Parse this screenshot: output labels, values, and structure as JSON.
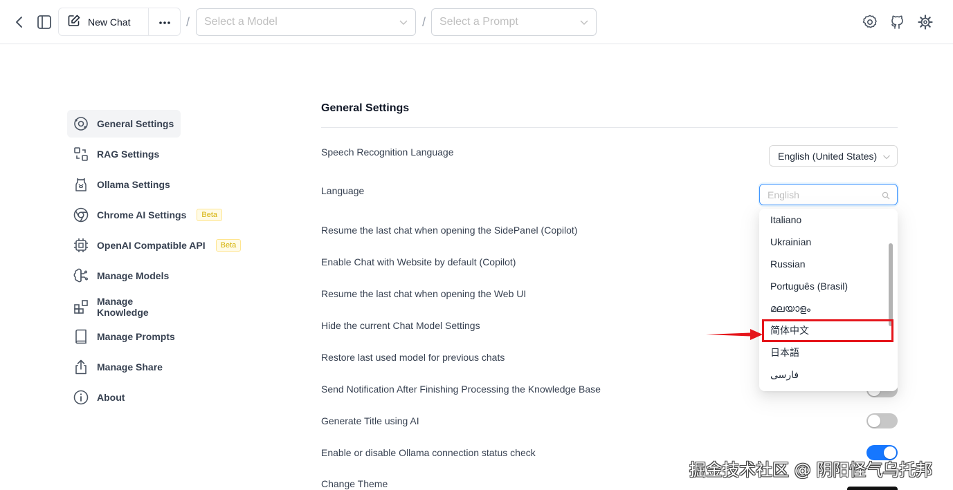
{
  "topbar": {
    "new_chat_label": "New Chat",
    "model_placeholder": "Select a Model",
    "prompt_placeholder": "Select a Prompt",
    "separator": "/"
  },
  "sidebar": {
    "items": [
      {
        "label": "General Settings",
        "icon": "settings-orbit-icon",
        "active": true
      },
      {
        "label": "RAG Settings",
        "icon": "rag-icon"
      },
      {
        "label": "Ollama Settings",
        "icon": "ollama-llama-icon"
      },
      {
        "label": "Chrome AI Settings",
        "icon": "chrome-icon",
        "badge": "Beta"
      },
      {
        "label": "OpenAI Compatible API",
        "icon": "chip-icon",
        "badge": "Beta"
      },
      {
        "label": "Manage Models",
        "icon": "brain-icon"
      },
      {
        "label": "Manage Knowledge",
        "icon": "blocks-icon"
      },
      {
        "label": "Manage Prompts",
        "icon": "book-icon"
      },
      {
        "label": "Manage Share",
        "icon": "share-icon"
      },
      {
        "label": "About",
        "icon": "info-icon"
      }
    ]
  },
  "main": {
    "title": "General Settings",
    "rows": [
      {
        "label": "Speech Recognition Language"
      },
      {
        "label": "Language"
      },
      {
        "label": "Resume the last chat when opening the SidePanel (Copilot)"
      },
      {
        "label": "Enable Chat with Website by default (Copilot)"
      },
      {
        "label": "Resume the last chat when opening the Web UI"
      },
      {
        "label": "Hide the current Chat Model Settings"
      },
      {
        "label": "Restore last used model for previous chats"
      },
      {
        "label": "Send Notification After Finishing Processing the Knowledge Base"
      },
      {
        "label": "Generate Title using AI"
      },
      {
        "label": "Enable or disable Ollama connection status check"
      },
      {
        "label": "Change Theme"
      }
    ],
    "speech_language_value": "English (United States)",
    "language_search_placeholder": "English",
    "language_options": [
      "Italiano",
      "Ukrainian",
      "Russian",
      "Português (Brasil)",
      "മലയാളം",
      "简体中文",
      "日本語",
      "فارسی"
    ],
    "highlighted_option": "简体中文",
    "toggles": {
      "send_notification": false,
      "generate_title": false,
      "ollama_status_check": true
    }
  },
  "watermark": "掘金技术社区 @ 阴阳怪气乌托邦",
  "colors": {
    "accent": "#1677ff",
    "annotation_red": "#e5151b"
  }
}
